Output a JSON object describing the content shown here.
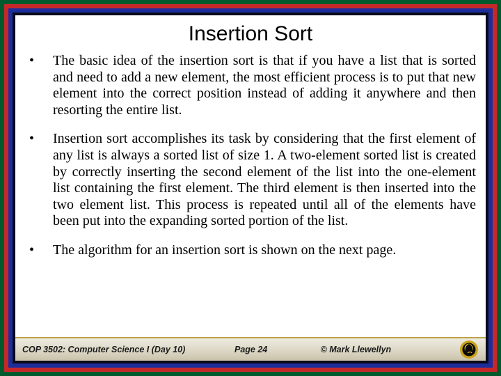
{
  "title": "Insertion Sort",
  "bullets": [
    "The basic idea of the insertion sort is that if you have a list that is sorted and need to add a new element, the most efficient process is to put that new element into the correct position instead of adding it anywhere and then resorting the entire list.",
    "Insertion sort accomplishes its task by considering that the first element of any list is always a sorted list of size 1.  A two-element sorted list is created by correctly inserting the second element of the list into the one-element list containing the first element.  The third element is then inserted into the two element list.  This process is repeated until all of the elements have been put into the expanding sorted portion of the list.",
    "The algorithm for an insertion sort is shown on the next page."
  ],
  "footer": {
    "course": "COP 3502: Computer Science I  (Day 10)",
    "page": "Page 24",
    "copyright": "© Mark Llewellyn"
  },
  "colors": {
    "border_outer": "#005a2e",
    "border_mid": "#c62828",
    "border_inner": "#1d2e9c",
    "border_dark": "#0a0a1a",
    "logo_gold": "#c8a31a",
    "logo_black": "#0a0a0a"
  }
}
